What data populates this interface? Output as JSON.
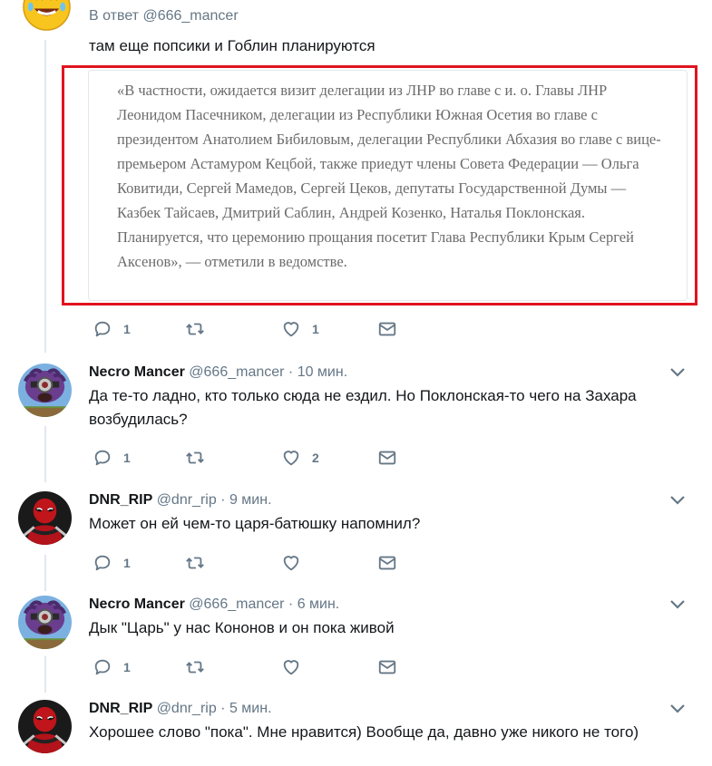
{
  "tweets": [
    {
      "reply_to_prefix": "В ответ",
      "reply_to_handle": "@666_mancer",
      "text": "там еще попсики и Гоблин планируются",
      "quote": "«В частности, ожидается визит делегации из ЛНР во главе с и. о. Главы ЛНР Леонидом Пасечником, делегации из Республики Южная Осетия во главе с президентом Анатолием Бибиловым, делегации Республики Абхазия во главе с вице-премьером Астамуром Кецбой, также приедут члены Совета Федерации — Ольга Ковитиди, Сергей Мамедов, Сергей Цеков, депутаты Государственной Думы — Казбек Тайсаев, Дмитрий Саблин, Андрей Козенко, Наталья Поклонская. Планируется, что церемонию прощания посетит Глава Республики Крым Сергей Аксенов», — отметили в ведомстве.",
      "replies": "1",
      "retweets": "",
      "likes": "1",
      "avatar_icon": "emoji-laughing-icon"
    },
    {
      "name": "Necro Mancer",
      "handle": "@666_mancer",
      "time": "10 мин.",
      "text": "Да те-то ладно, кто только сюда не ездил. Но Поклонская-то чего на Захара возбудилась?",
      "replies": "1",
      "retweets": "",
      "likes": "2",
      "avatar_icon": "minion-avatar-icon"
    },
    {
      "name": "DNR_RIP",
      "handle": "@dnr_rip",
      "time": "9 мин.",
      "text": "Может  он ей чем-то царя-батюшку напомнил?",
      "replies": "1",
      "retweets": "",
      "likes": "",
      "avatar_icon": "deadpool-avatar-icon"
    },
    {
      "name": "Necro Mancer",
      "handle": "@666_mancer",
      "time": "6 мин.",
      "text": "Дык \"Царь\" у нас Кононов и он пока живой",
      "replies": "1",
      "retweets": "",
      "likes": "",
      "avatar_icon": "minion-avatar-icon"
    },
    {
      "name": "DNR_RIP",
      "handle": "@dnr_rip",
      "time": "5 мин.",
      "text": "Хорошее слово \"пока\". Мне нравится) Вообще да, давно уже никого не того)",
      "avatar_icon": "deadpool-avatar-icon"
    }
  ],
  "separator": " · ",
  "colors": {
    "icon": "#657786",
    "highlight": "#e0131f",
    "thread_line": "#e1e8ed"
  }
}
